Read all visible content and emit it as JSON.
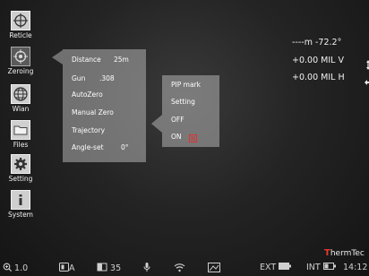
{
  "sidebar": {
    "items": [
      {
        "label": "Reticle",
        "icon": "crosshair-icon"
      },
      {
        "label": "Zeroing",
        "icon": "target-icon"
      },
      {
        "label": "Wlan",
        "icon": "globe-icon"
      },
      {
        "label": "Files",
        "icon": "folder-icon"
      },
      {
        "label": "Setting",
        "icon": "gear-icon"
      },
      {
        "label": "System",
        "icon": "info-icon"
      }
    ]
  },
  "zeroing_menu": {
    "distance_label": "Distance",
    "distance_value": "25m",
    "gun_label": "Gun",
    "gun_value": ".308",
    "autozero_label": "AutoZero",
    "manual_zero_label": "Manual Zero",
    "trajectory_label": "Trajectory",
    "angle_label": "Angle-set",
    "angle_value": "0°"
  },
  "pip_menu": {
    "title": "PIP mark",
    "setting_label": "Setting",
    "off_label": "OFF",
    "on_label": "ON"
  },
  "readouts": {
    "range": "----m -72.2°",
    "vertical": "+0.00 MIL V",
    "horizontal": "+0.00 MIL H"
  },
  "brand": {
    "first": "T",
    "rest": "hermTec"
  },
  "statusbar": {
    "zoom": "1.0",
    "mode": "A",
    "brightness": "35",
    "ext_label": "EXT",
    "int_label": "INT",
    "time": "14:12"
  }
}
